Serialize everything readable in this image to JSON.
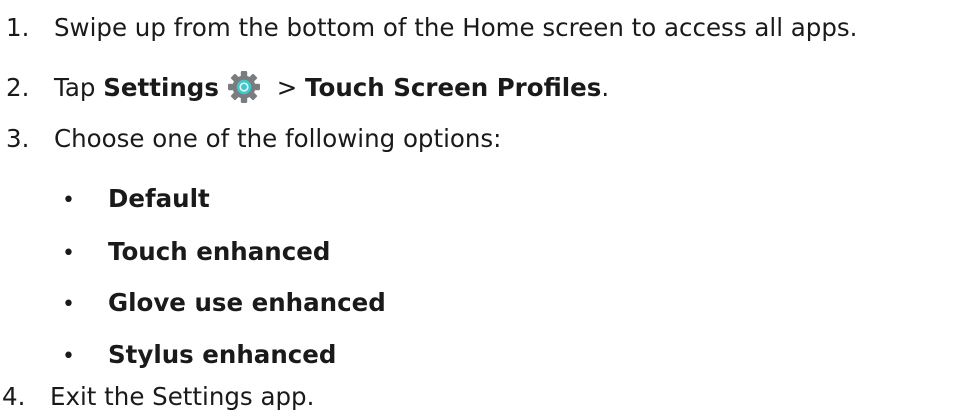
{
  "steps": [
    {
      "number": "1.",
      "text": "Swipe up from the bottom of the Home screen to access all apps."
    },
    {
      "number": "2.",
      "prefix": "Tap ",
      "settings_label": "Settings",
      "separator": " > ",
      "target_label": "Touch Screen Profiles",
      "suffix": "."
    },
    {
      "number": "3.",
      "text": "Choose one of the following options:"
    },
    {
      "number": "4.",
      "text": "Exit the Settings app."
    }
  ],
  "options": [
    {
      "bullet": "•",
      "label": "Default"
    },
    {
      "bullet": "•",
      "label": "Touch enhanced"
    },
    {
      "bullet": "•",
      "label": "Glove use enhanced"
    },
    {
      "bullet": "•",
      "label": "Stylus enhanced"
    }
  ],
  "icons": {
    "settings_icon": "settings-gear-icon",
    "gear_color": "#7a7d80",
    "gear_center_color": "#3fc7c9"
  }
}
